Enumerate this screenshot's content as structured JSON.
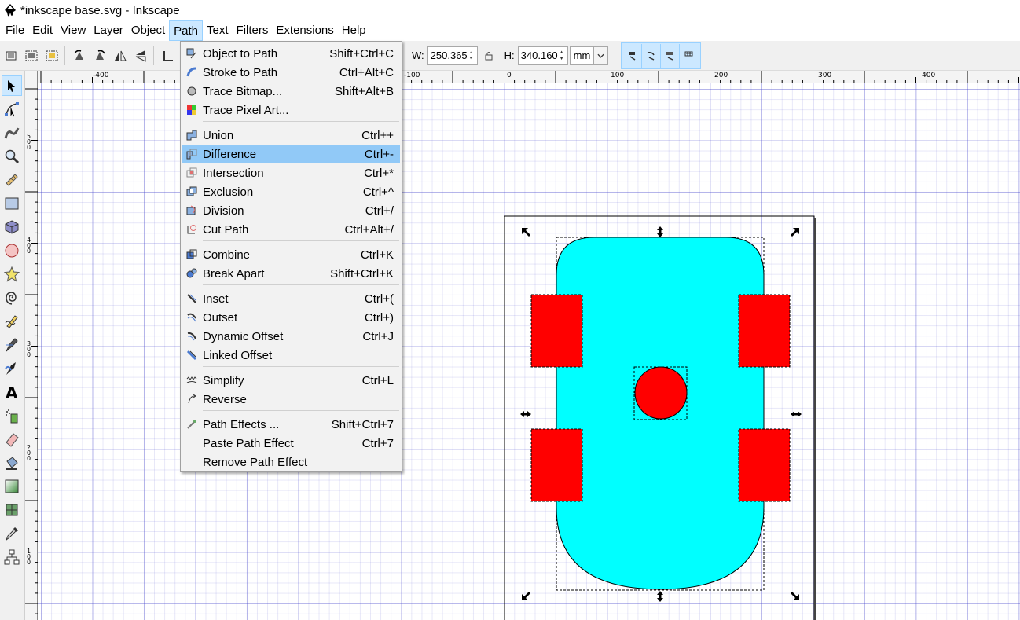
{
  "window": {
    "title": "*inkscape base.svg - Inkscape"
  },
  "menubar": {
    "items": [
      {
        "label": "File"
      },
      {
        "label": "Edit"
      },
      {
        "label": "View"
      },
      {
        "label": "Layer"
      },
      {
        "label": "Object"
      },
      {
        "label": "Path"
      },
      {
        "label": "Text"
      },
      {
        "label": "Filters"
      },
      {
        "label": "Extensions"
      },
      {
        "label": "Help"
      }
    ],
    "active": "Path"
  },
  "toolbar": {
    "w_label": "W:",
    "w_value": "250.365",
    "h_label": "H:",
    "h_value": "340.160",
    "unit": "mm"
  },
  "ruler_top": {
    "labels": [
      "-400",
      "-100",
      "0",
      "100",
      "200",
      "300",
      "400"
    ]
  },
  "ruler_left": {
    "labels": [
      "5\n0\n0",
      "4\n0\n0",
      "3\n0\n0",
      "2\n0\n0",
      "1\n0\n0"
    ]
  },
  "path_menu": {
    "items": [
      {
        "label": "Object to Path",
        "accel": "Shift+Ctrl+C",
        "icon": "object-to-path-icon"
      },
      {
        "label": "Stroke to Path",
        "accel": "Ctrl+Alt+C",
        "icon": "stroke-to-path-icon"
      },
      {
        "label": "Trace Bitmap...",
        "accel": "Shift+Alt+B",
        "icon": "trace-bitmap-icon"
      },
      {
        "label": "Trace Pixel Art...",
        "accel": "",
        "icon": "trace-pixel-art-icon"
      },
      {
        "label": "Union",
        "accel": "Ctrl++",
        "icon": "union-icon"
      },
      {
        "label": "Difference",
        "accel": "Ctrl+-",
        "icon": "difference-icon"
      },
      {
        "label": "Intersection",
        "accel": "Ctrl+*",
        "icon": "intersection-icon"
      },
      {
        "label": "Exclusion",
        "accel": "Ctrl+^",
        "icon": "exclusion-icon"
      },
      {
        "label": "Division",
        "accel": "Ctrl+/",
        "icon": "division-icon"
      },
      {
        "label": "Cut Path",
        "accel": "Ctrl+Alt+/",
        "icon": "cut-path-icon"
      },
      {
        "label": "Combine",
        "accel": "Ctrl+K",
        "icon": "combine-icon"
      },
      {
        "label": "Break Apart",
        "accel": "Shift+Ctrl+K",
        "icon": "break-apart-icon"
      },
      {
        "label": "Inset",
        "accel": "Ctrl+(",
        "icon": "inset-icon"
      },
      {
        "label": "Outset",
        "accel": "Ctrl+)",
        "icon": "outset-icon"
      },
      {
        "label": "Dynamic Offset",
        "accel": "Ctrl+J",
        "icon": "dynamic-offset-icon"
      },
      {
        "label": "Linked Offset",
        "accel": "",
        "icon": "linked-offset-icon"
      },
      {
        "label": "Simplify",
        "accel": "Ctrl+L",
        "icon": "simplify-icon"
      },
      {
        "label": "Reverse",
        "accel": "",
        "icon": "reverse-icon"
      },
      {
        "label": "Path Effects ...",
        "accel": "Shift+Ctrl+7",
        "icon": "path-effects-icon"
      },
      {
        "label": "Paste Path Effect",
        "accel": "Ctrl+7",
        "icon": ""
      },
      {
        "label": "Remove Path Effect",
        "accel": "",
        "icon": ""
      }
    ],
    "highlighted": "Difference"
  },
  "colors": {
    "body_fill": "#00ffff",
    "part_fill": "#ff0000",
    "menu_highlight": "#91c9f7",
    "active_menu_bg": "#cce8ff"
  }
}
